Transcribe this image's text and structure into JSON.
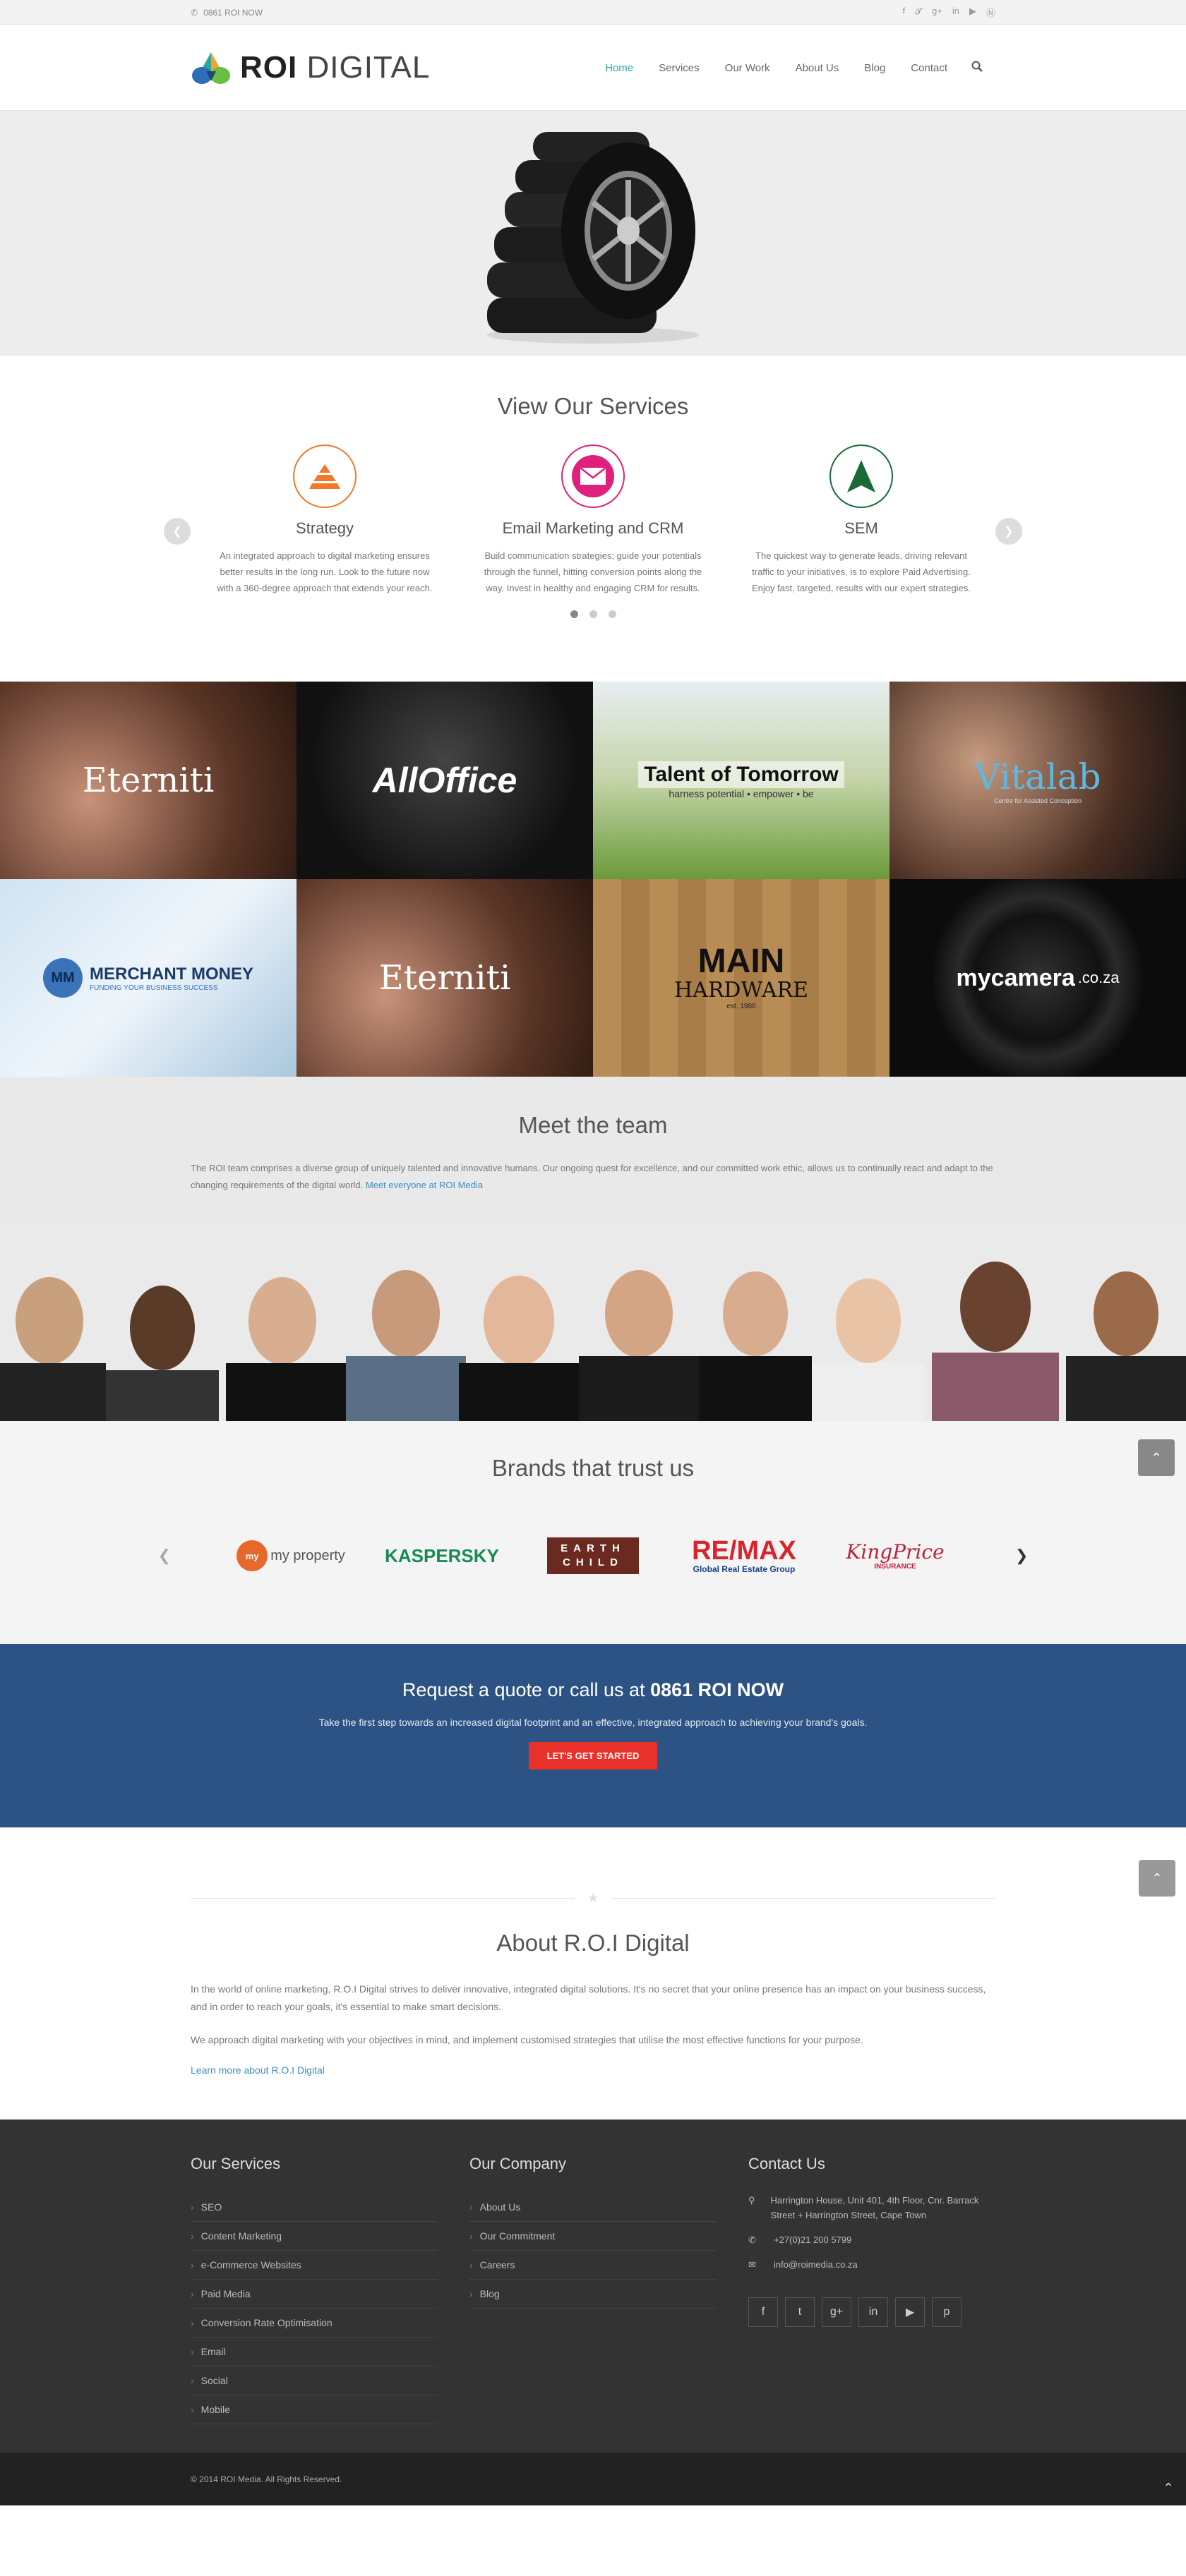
{
  "topbar": {
    "phone": "0861 ROI NOW",
    "social": [
      "facebook-icon",
      "twitter-icon",
      "google-plus-icon",
      "linkedin-icon",
      "youtube-icon",
      "pinterest-icon"
    ]
  },
  "header": {
    "logo_bold": "ROI",
    "logo_light": "DIGITAL",
    "nav": [
      "Home",
      "Services",
      "Our Work",
      "About Us",
      "Blog",
      "Contact"
    ],
    "active": "Home"
  },
  "services": {
    "title": "View Our Services",
    "items": [
      {
        "title": "Strategy",
        "text": "An integrated approach to digital marketing ensures better results in the long run. Look to the future now with a 360-degree approach that extends your reach.",
        "color": "#f07a2a",
        "icon": "pyramid-icon"
      },
      {
        "title": "Email Marketing and CRM",
        "text": "Build communication strategies; guide your potentials through the funnel, hitting conversion points along the way. Invest in healthy and engaging CRM for results.",
        "color": "#e0207c",
        "icon": "envelope-icon"
      },
      {
        "title": "SEM",
        "text": "The quickest way to generate leads, driving relevant traffic to your initiatives, is to explore Paid Advertising. Enjoy fast, targeted, results with our expert strategies.",
        "color": "#1b6b3a",
        "icon": "arrow-up-icon"
      }
    ]
  },
  "portfolio": [
    {
      "name": "Eterniti"
    },
    {
      "name": "AllOffice"
    },
    {
      "name": "Talent of Tomorrow",
      "tagline": "harness potential • empower • be"
    },
    {
      "name": "Vitalab",
      "tagline": "Centre for Assisted Conception"
    },
    {
      "name": "MERCHANT MONEY",
      "tagline": "FUNDING YOUR BUSINESS SUCCESS"
    },
    {
      "name": "Eterniti"
    },
    {
      "name": "MAIN",
      "name2": "HARDWARE",
      "tagline": "est. 1986"
    },
    {
      "name": "mycamera",
      "tagline": ".co.za"
    }
  ],
  "team": {
    "title": "Meet the team",
    "text": "The ROI team comprises a diverse group of uniquely talented and innovative humans. Our ongoing quest for excellence, and our committed work ethic, allows us to continually react and adapt to the changing requirements of the digital world.",
    "link": "Meet everyone at ROI Media"
  },
  "brands": {
    "title": "Brands that trust us",
    "logos": [
      {
        "name": "my property",
        "color": "#e8682b"
      },
      {
        "name": "KASPERSKY",
        "color": "#1a8a55"
      },
      {
        "name": "EARTH CHILD",
        "color": "#6b2a20"
      },
      {
        "name": "RE/MAX",
        "sub": "Global Real Estate Group",
        "color": "#d4262c"
      },
      {
        "name": "KingPrice",
        "sub": "INSURANCE",
        "color": "#c0213b"
      }
    ]
  },
  "cta": {
    "title_prefix": "Request a quote or call us at ",
    "title_bold": "0861 ROI NOW",
    "text": "Take the first step towards an increased digital footprint and an effective, integrated approach to achieving your brand's goals.",
    "button": "LET'S GET STARTED"
  },
  "about": {
    "title": "About R.O.I Digital",
    "p1": "In the world of online marketing, R.O.I Digital strives to deliver innovative, integrated digital solutions. It's no secret that your online presence has an impact on your business success, and in order to reach your goals, it's essential to make smart decisions.",
    "p2": "We approach digital marketing with your objectives in mind, and implement customised strategies that utilise the most effective functions for your purpose.",
    "link": "Learn more about R.O.I Digital"
  },
  "footer": {
    "services_title": "Our Services",
    "services": [
      "SEO",
      "Content Marketing",
      "e-Commerce Websites",
      "Paid Media",
      "Conversion Rate Optimisation",
      "Email",
      "Social",
      "Mobile"
    ],
    "company_title": "Our Company",
    "company": [
      "About Us",
      "Our Commitment",
      "Careers",
      "Blog"
    ],
    "contact_title": "Contact Us",
    "address": "Harrington House, Unit 401, 4th Floor, Cnr. Barrack Street + Harrington Street, Cape Town",
    "phone": "+27(0)21 200 5799",
    "email": "info@roimedia.co.za",
    "copyright": "© 2014 ROI Media. All Rights Reserved."
  },
  "colors": {
    "accent": "#2ba7a0",
    "cta_bg": "#2c5384",
    "cta_button": "#e9302b",
    "footer_bg": "#333333"
  }
}
